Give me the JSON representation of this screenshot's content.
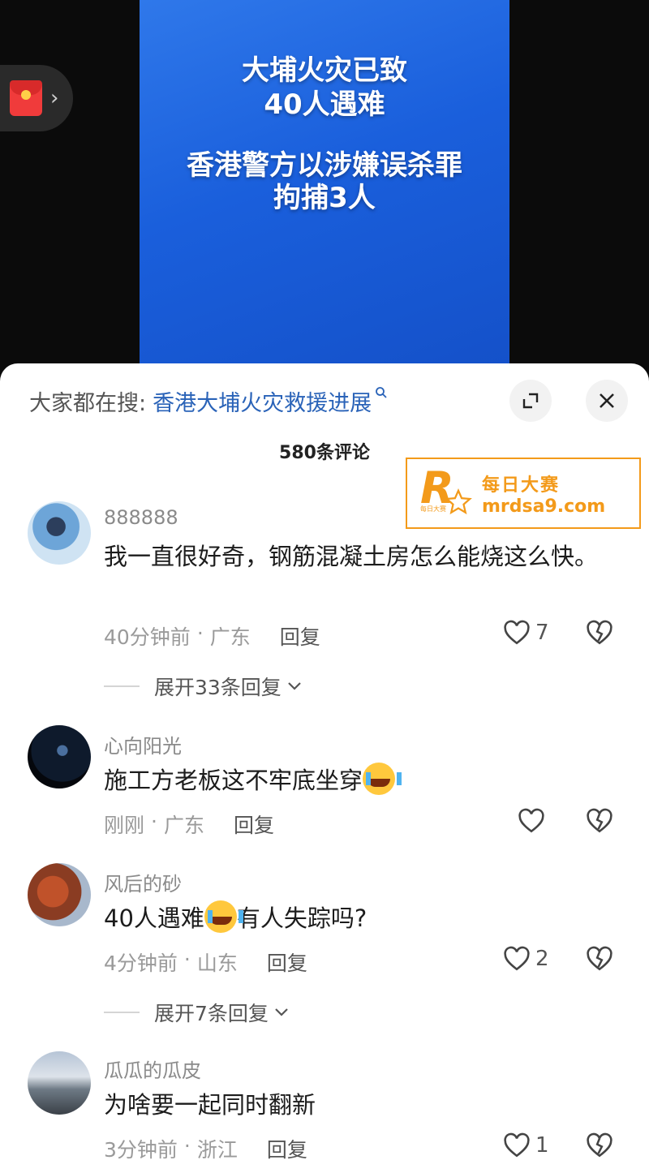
{
  "video": {
    "headline_line1": "大埔火灾已致",
    "headline_line2": "40人遇难",
    "sub_line1": "香港警方以涉嫌误杀罪",
    "sub_line2": "拘捕3人"
  },
  "search": {
    "prefix": "大家都在搜:",
    "term": "香港大埔火灾救援进展"
  },
  "comment_count": "580条评论",
  "watermark": {
    "logo_small": "每日大赛",
    "title": "每日大赛",
    "url": "mrdsa9.com"
  },
  "comments": [
    {
      "username": "888888",
      "text": "我一直很好奇，钢筋混凝土房怎么能烧这么快。",
      "time": "40分钟前",
      "location": "广东",
      "reply_label": "回复",
      "likes": "7",
      "expand_label": "展开33条回复"
    },
    {
      "username": "心向阳光",
      "text": "施工方老板这不牢底坐穿",
      "time": "刚刚",
      "location": "广东",
      "reply_label": "回复",
      "likes": ""
    },
    {
      "username": "风后的砂",
      "text_before": "40人遇难",
      "text_after": "有人失踪吗?",
      "time": "4分钟前",
      "location": "山东",
      "reply_label": "回复",
      "likes": "2",
      "expand_label": "展开7条回复"
    },
    {
      "username": "瓜瓜的瓜皮",
      "text": "为啥要一起同时翻新",
      "time": "3分钟前",
      "location": "浙江",
      "reply_label": "回复",
      "likes": "1"
    }
  ],
  "icons": {
    "like": "heart-outline-icon",
    "dislike": "broken-heart-icon",
    "close": "close-icon",
    "expand": "expand-icon",
    "search": "search-icon",
    "chevron": "chevron-down-icon"
  }
}
